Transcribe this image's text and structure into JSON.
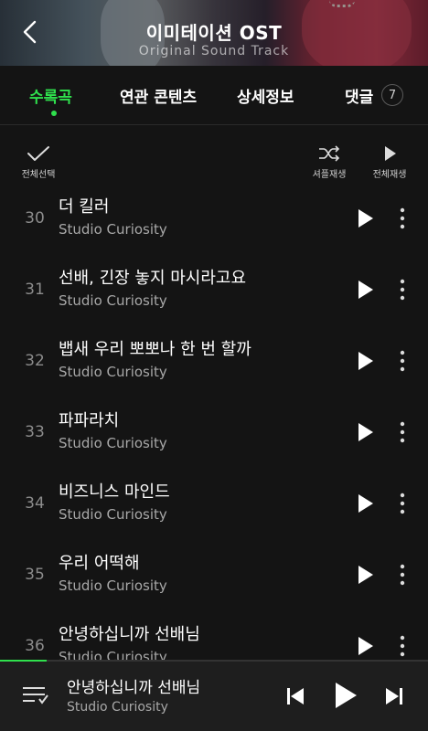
{
  "header": {
    "title": "이미테이션 OST",
    "subtitle": "Original Sound Track",
    "back_icon": "chevron-left-icon"
  },
  "tabs": [
    {
      "label": "수록곡",
      "active": true
    },
    {
      "label": "연관 콘텐츠",
      "active": false
    },
    {
      "label": "상세정보",
      "active": false
    },
    {
      "label": "댓글",
      "active": false,
      "count": "7"
    }
  ],
  "toolbar": {
    "select_all": "전체선택",
    "shuffle_play": "셔플재생",
    "play_all": "전체재생"
  },
  "tracks": [
    {
      "no": "30",
      "title": "더 킬러",
      "artist": "Studio Curiosity"
    },
    {
      "no": "31",
      "title": "선배, 긴장 놓지 마시라고요",
      "artist": "Studio Curiosity"
    },
    {
      "no": "32",
      "title": "뱁새 우리 뽀뽀나 한 번 할까",
      "artist": "Studio Curiosity"
    },
    {
      "no": "33",
      "title": "파파라치",
      "artist": "Studio Curiosity"
    },
    {
      "no": "34",
      "title": "비즈니스 마인드",
      "artist": "Studio Curiosity"
    },
    {
      "no": "35",
      "title": "우리 어떡해",
      "artist": "Studio Curiosity"
    },
    {
      "no": "36",
      "title": "안녕하십니까 선배님",
      "artist": "Studio Curiosity"
    }
  ],
  "player": {
    "title": "안녕하십니까 선배님",
    "artist": "Studio Curiosity",
    "progress_percent": 11
  },
  "colors": {
    "accent": "#2fe04d",
    "background": "#141414",
    "player_background": "#1e1e1e"
  }
}
